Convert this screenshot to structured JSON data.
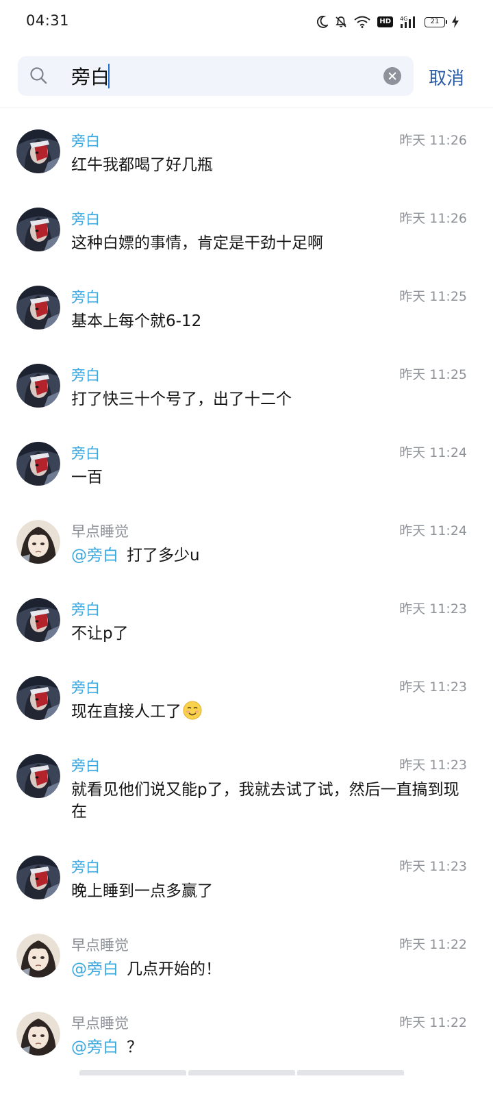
{
  "status_bar": {
    "time": "04:31",
    "icons": [
      "moon-icon",
      "mute-bell-icon",
      "wifi-icon",
      "hd-icon",
      "signal-4g-icon",
      "battery-icon",
      "charging-icon"
    ],
    "hd_label": "HD",
    "network_label": "4G",
    "battery_level": "21"
  },
  "search": {
    "query": "旁白",
    "placeholder": "",
    "cancel_label": "取消"
  },
  "colors": {
    "highlight": "#3aa7df",
    "cancel": "#2b5ba6",
    "search_bg": "#f1f4fa",
    "time_gray": "#8e9299"
  },
  "results": [
    {
      "sender": "旁白",
      "time": "昨天 11:26",
      "text": "红牛我都喝了好几瓶"
    },
    {
      "sender": "旁白",
      "time": "昨天 11:26",
      "text": "这种白嫖的事情，肯定是干劲十足啊"
    },
    {
      "sender": "旁白",
      "time": "昨天 11:25",
      "text": "基本上每个就6-12"
    },
    {
      "sender": "旁白",
      "time": "昨天 11:25",
      "text": "打了快三十个号了，出了十二个"
    },
    {
      "sender": "旁白",
      "time": "昨天 11:24",
      "text": "一百"
    },
    {
      "sender": "早点睡觉",
      "time": "昨天 11:24",
      "mention": "旁白",
      "text": "打了多少u"
    },
    {
      "sender": "旁白",
      "time": "昨天 11:23",
      "text": "不让p了"
    },
    {
      "sender": "旁白",
      "time": "昨天 11:23",
      "text": "现在直接人工了",
      "emoji": "smile-emoji"
    },
    {
      "sender": "旁白",
      "time": "昨天 11:23",
      "text": "就看见他们说又能p了，我就去试了试，然后一直搞到现在"
    },
    {
      "sender": "旁白",
      "time": "昨天 11:23",
      "text": "晚上睡到一点多赢了"
    },
    {
      "sender": "早点睡觉",
      "time": "昨天 11:22",
      "mention": "旁白",
      "text": "几点开始的！"
    },
    {
      "sender": "早点睡觉",
      "time": "昨天 11:22",
      "mention": "旁白",
      "text": "？"
    }
  ]
}
